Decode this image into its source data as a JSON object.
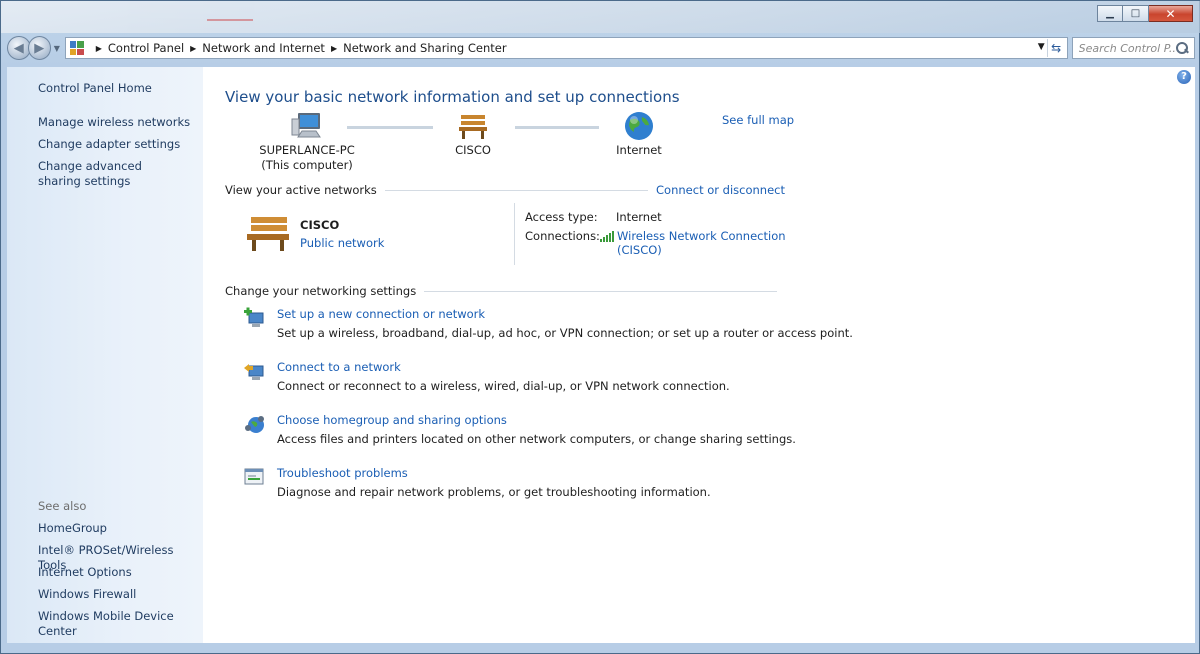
{
  "window": {
    "minimize_glyph": "▁",
    "maximize_glyph": "□",
    "close_glyph": "✕"
  },
  "address_bar": {
    "crumbs": [
      "Control Panel",
      "Network and Internet",
      "Network and Sharing Center"
    ],
    "search_placeholder": "Search Control P..."
  },
  "sidebar": {
    "home": "Control Panel Home",
    "links": [
      "Manage wireless networks",
      "Change adapter settings",
      "Change advanced sharing settings"
    ],
    "see_also_label": "See also",
    "see_also": [
      "HomeGroup",
      "Intel® PROSet/Wireless Tools",
      "Internet Options",
      "Windows Firewall",
      "Windows Mobile Device Center"
    ]
  },
  "main": {
    "title": "View your basic network information and set up connections",
    "see_full_map": "See full map",
    "map": {
      "computer": "SUPERLANCE-PC",
      "computer_sub": "(This computer)",
      "network": "CISCO",
      "internet": "Internet"
    },
    "active_networks": {
      "header": "View your active networks",
      "action": "Connect or disconnect",
      "network_name": "CISCO",
      "network_type": "Public network",
      "access_type_label": "Access type:",
      "access_type_value": "Internet",
      "connections_label": "Connections:",
      "connection_link": "Wireless Network Connection (CISCO)"
    },
    "settings": {
      "header": "Change your networking settings",
      "tasks": [
        {
          "link": "Set up a new connection or network",
          "desc": "Set up a wireless, broadband, dial-up, ad hoc, or VPN connection; or set up a router or access point.",
          "icon": "new-connection-icon"
        },
        {
          "link": "Connect to a network",
          "desc": "Connect or reconnect to a wireless, wired, dial-up, or VPN network connection.",
          "icon": "connect-network-icon"
        },
        {
          "link": "Choose homegroup and sharing options",
          "desc": "Access files and printers located on other network computers, or change sharing settings.",
          "icon": "homegroup-icon"
        },
        {
          "link": "Troubleshoot problems",
          "desc": "Diagnose and repair network problems, or get troubleshooting information.",
          "icon": "troubleshoot-icon"
        }
      ]
    }
  },
  "colors": {
    "link": "#1a5eb4",
    "title": "#1e4e8c",
    "sidebar_bg": "#dbe8f6"
  }
}
